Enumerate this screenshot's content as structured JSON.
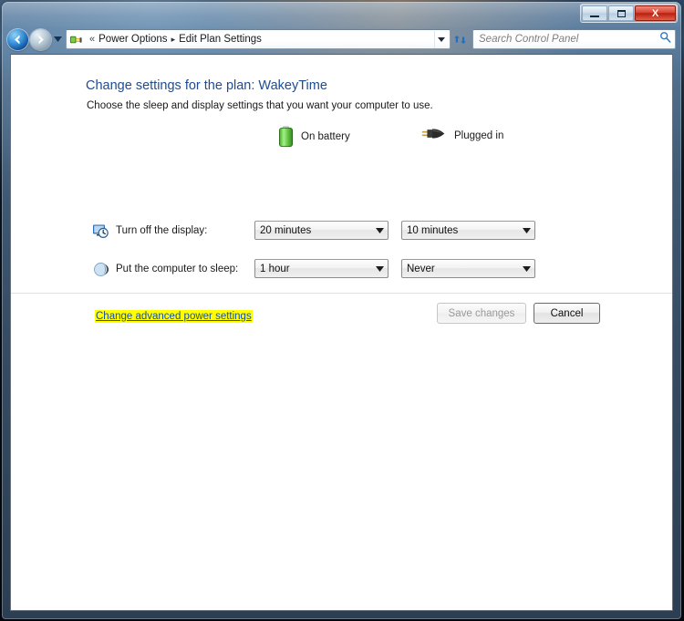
{
  "window": {
    "caption_buttons": {
      "minimize_label": "Minimize",
      "maximize_label": "Maximize",
      "close_label": "X"
    }
  },
  "navbar": {
    "back_icon": "back-arrow-icon",
    "forward_icon": "forward-arrow-icon",
    "history_dropdown_icon": "chevron-down-icon",
    "breadcrumb_icon": "power-plug-icon",
    "breadcrumb_overflow": "«",
    "breadcrumb": [
      {
        "label": "Power Options"
      },
      {
        "label": "Edit Plan Settings"
      }
    ],
    "separator": "▸",
    "address_dropdown_icon": "chevron-down-icon",
    "refresh_icon": "refresh-icon",
    "search": {
      "placeholder": "Search Control Panel",
      "value": "",
      "icon": "search-icon"
    }
  },
  "page": {
    "title": "Change settings for the plan: WakeyTime",
    "subtitle": "Choose the sleep and display settings that you want your computer to use.",
    "columns": [
      {
        "id": "battery",
        "label": "On battery",
        "icon": "battery-icon"
      },
      {
        "id": "plugged",
        "label": "Plugged in",
        "icon": "power-plug-icon"
      }
    ],
    "rows": [
      {
        "id": "display",
        "icon": "monitor-clock-icon",
        "label": "Turn off the display:",
        "battery_value": "20 minutes",
        "plugged_value": "10 minutes"
      },
      {
        "id": "sleep",
        "icon": "moon-icon",
        "label": "Put the computer to sleep:",
        "battery_value": "1 hour",
        "plugged_value": "Never"
      }
    ],
    "advanced_link": "Change advanced power settings",
    "buttons": {
      "save": "Save changes",
      "cancel": "Cancel"
    }
  },
  "colors": {
    "link_blue": "#1b4f9c",
    "title_blue": "#1e4c91",
    "highlight_yellow": "#ffff00",
    "battery_green": "#6fd34f",
    "close_red": "#d8442f"
  }
}
